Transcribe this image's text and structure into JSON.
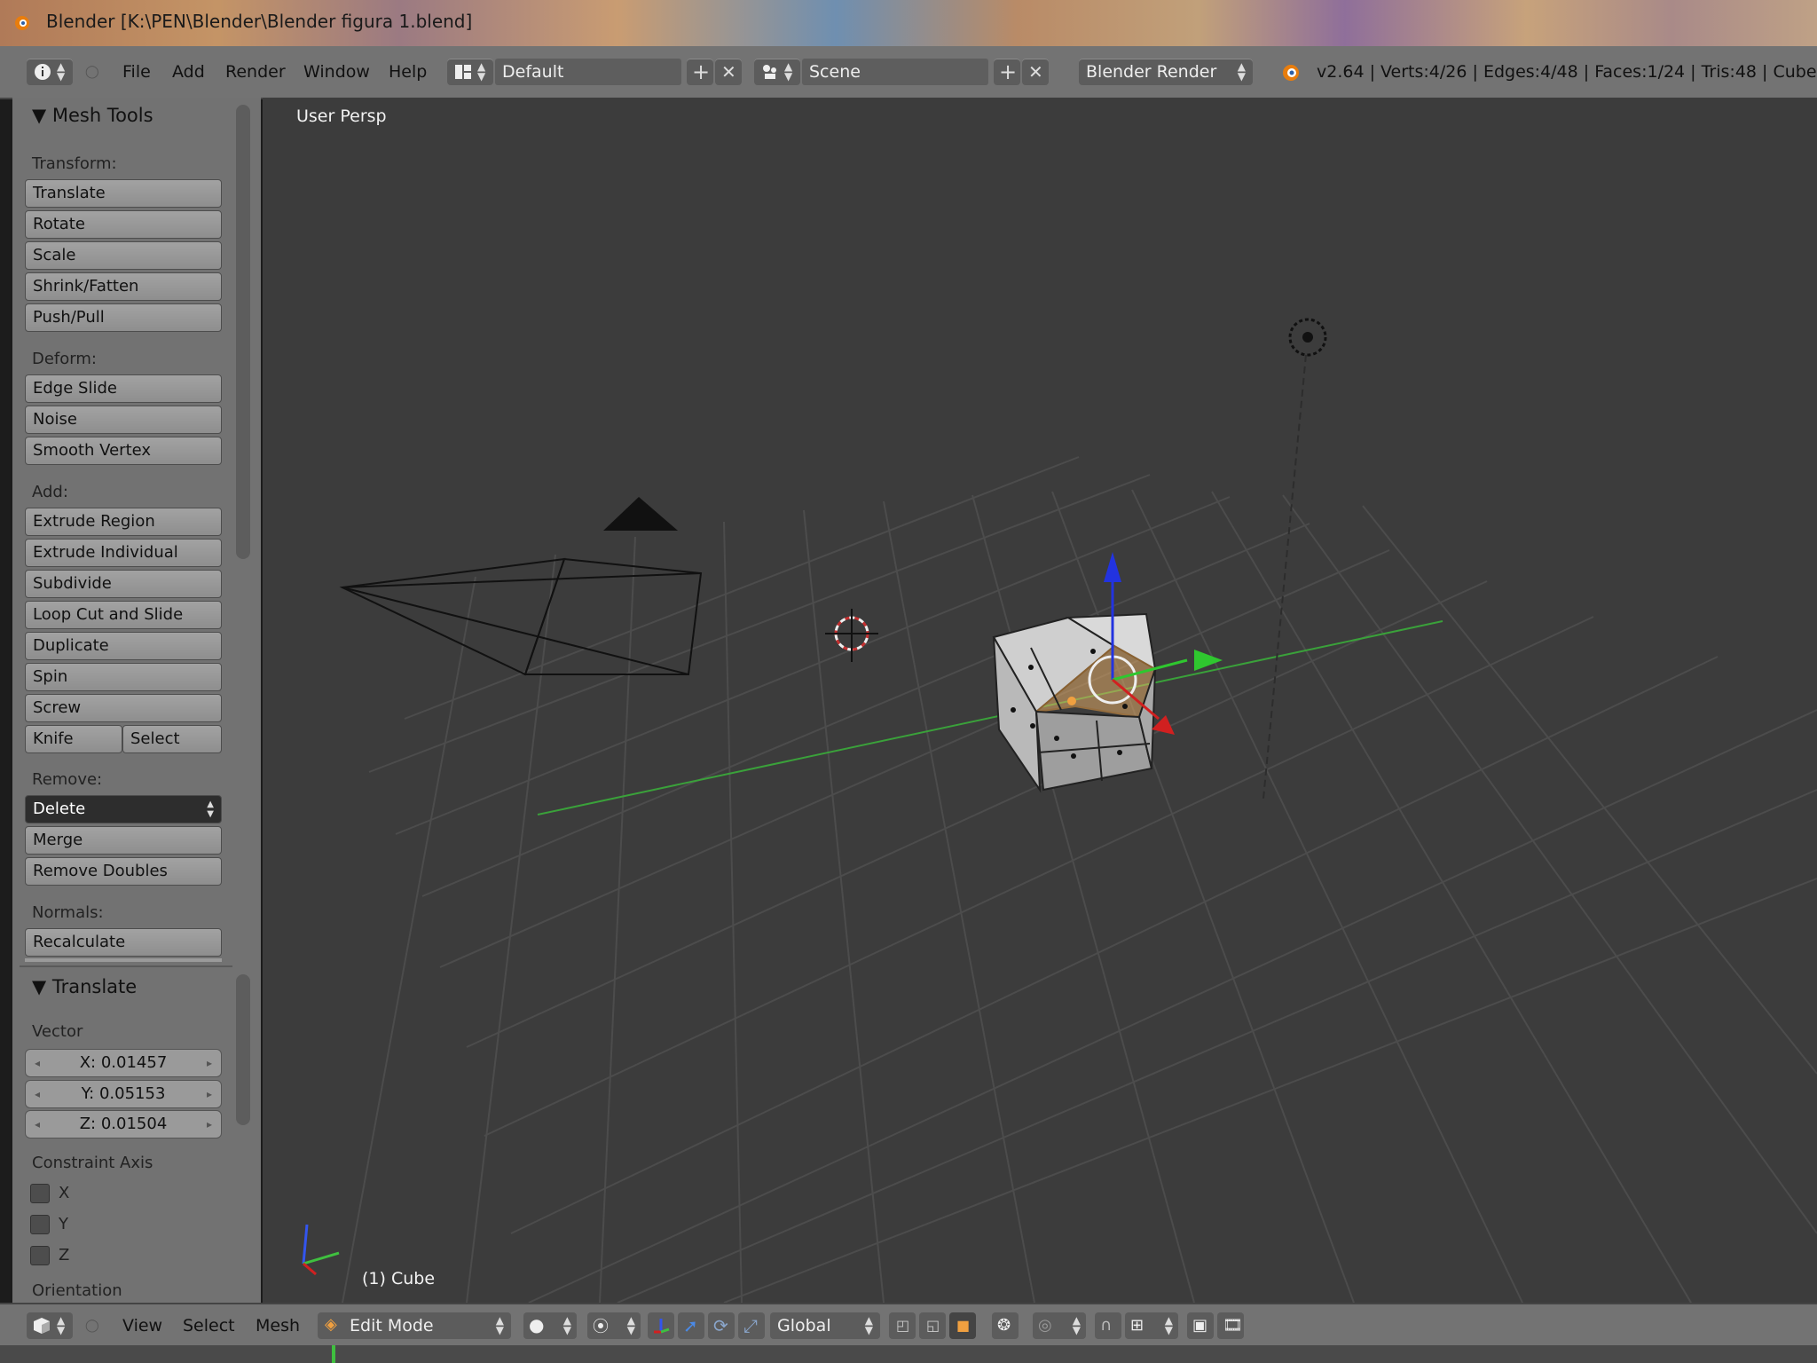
{
  "window": {
    "title": "Blender [K:\\PEN\\Blender\\Blender figura 1.blend]"
  },
  "menubar": {
    "items": [
      "File",
      "Add",
      "Render",
      "Window",
      "Help"
    ],
    "layout_value": "Default",
    "scene_value": "Scene",
    "engine_value": "Blender Render",
    "stats": "v2.64 | Verts:4/26 | Edges:4/48 | Faces:1/24 | Tris:48 | Cube"
  },
  "mesh_tools": {
    "header": "Mesh Tools",
    "transform_label": "Transform:",
    "transform": [
      "Translate",
      "Rotate",
      "Scale",
      "Shrink/Fatten",
      "Push/Pull"
    ],
    "deform_label": "Deform:",
    "deform": [
      "Edge Slide",
      "Noise",
      "Smooth Vertex"
    ],
    "add_label": "Add:",
    "add": [
      "Extrude Region",
      "Extrude Individual",
      "Subdivide",
      "Loop Cut and Slide",
      "Duplicate",
      "Spin",
      "Screw"
    ],
    "knife": "Knife",
    "select": "Select",
    "remove_label": "Remove:",
    "delete": "Delete",
    "remove": [
      "Merge",
      "Remove Doubles"
    ],
    "normals_label": "Normals:",
    "recalculate": "Recalculate"
  },
  "translate_panel": {
    "header": "Translate",
    "vector_label": "Vector",
    "x": "X: 0.01457",
    "y": "Y: 0.05153",
    "z": "Z: 0.01504",
    "constraint_label": "Constraint Axis",
    "axes": [
      "X",
      "Y",
      "Z"
    ],
    "orientation_label": "Orientation"
  },
  "viewport": {
    "title": "User Persp",
    "object": "(1) Cube"
  },
  "bottombar": {
    "items": [
      "View",
      "Select",
      "Mesh"
    ],
    "mode_value": "Edit Mode",
    "orientation_value": "Global"
  },
  "colors": {
    "x_axis": "#d12020",
    "y_axis": "#2fc72f",
    "z_axis": "#2233e0",
    "viewport_bg": "#3c3c3c",
    "panel_bg": "#727272",
    "grid_line": "#4c4c4c",
    "grid_y_axis": "#3aa13a",
    "selection": "#f0a040"
  },
  "icons": [
    "blender-logo-icon",
    "info-editor-icon",
    "screen-layout-icon",
    "scene-icon",
    "add-icon",
    "remove-icon",
    "render-icon",
    "3d-view-editor-icon",
    "viewport-shading-icon",
    "pivot-icon",
    "manipulator-icon",
    "translate-manipulator-icon",
    "rotate-manipulator-icon",
    "scale-manipulator-icon",
    "vertex-select-icon",
    "edge-select-icon",
    "face-select-icon",
    "occlude-geometry-icon",
    "proportional-editing-icon",
    "snap-icon",
    "snap-target-icon",
    "opengl-render-icon",
    "opengl-animation-icon"
  ]
}
